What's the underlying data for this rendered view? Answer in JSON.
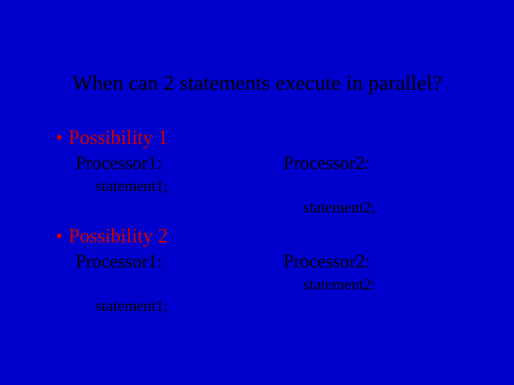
{
  "title": "When can 2 statements execute in parallel?",
  "p1": {
    "heading": "Possibility 1",
    "left": {
      "proc": "Processor1:",
      "stmt": "statement1;"
    },
    "right": {
      "proc": "Processor2:",
      "stmt": "statement2;"
    }
  },
  "p2": {
    "heading": "Possibility 2",
    "left": {
      "proc": "Processor1:",
      "stmt": "statement1;"
    },
    "right": {
      "proc": "Processor2:",
      "stmt": "statement2:"
    }
  }
}
